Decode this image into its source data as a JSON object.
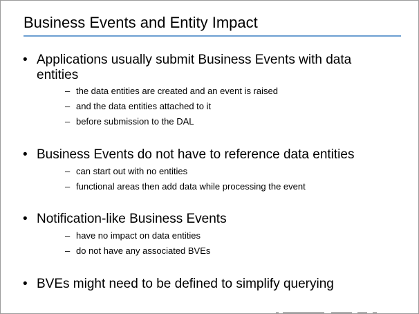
{
  "slide": {
    "title": "Business Events and Entity Impact",
    "bullet_glyph": "•",
    "dash_glyph": "–",
    "accent_color": "#6d9fd1",
    "bullets": [
      {
        "text": "Applications usually submit Business Events with data entities",
        "subs": [
          "the data entities are created and an event is raised",
          "and the data entities attached to it",
          "before submission to the DAL"
        ]
      },
      {
        "text": "Business Events do not have to reference data entities",
        "subs": [
          "can start out with no entities",
          "functional areas then add data while processing the event"
        ]
      },
      {
        "text": "Notification-like Business Events",
        "subs": [
          "have no impact on data entities",
          "do not have any associated BVEs"
        ]
      },
      {
        "text": "BVEs might need to be defined to simplify querying",
        "subs": []
      }
    ]
  }
}
